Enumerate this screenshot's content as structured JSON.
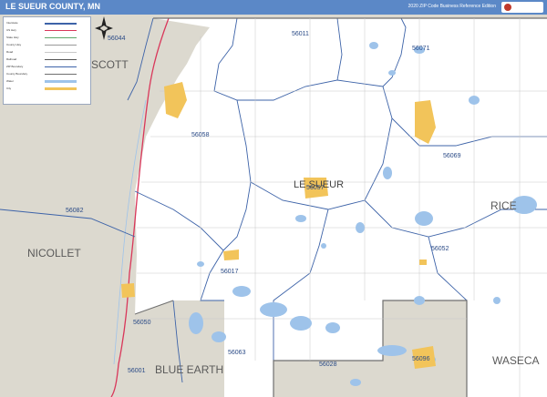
{
  "header": {
    "title": "LE SUEUR COUNTY, MN",
    "edition": "2020 ZIP Code Business Reference Edition",
    "brand": "Market MAPS"
  },
  "colors": {
    "county_fill": "#ffffff",
    "outside_fill": "#dcd9cf",
    "water": "#9ec3ea",
    "city": "#f2c45a",
    "zip_boundary": "#3d63a8",
    "river_red": "#d9375a",
    "header": "#5b88c7"
  },
  "map": {
    "zip_labels": [
      "56011",
      "56071",
      "56044",
      "56058",
      "56069",
      "56057",
      "56082",
      "56052",
      "56017",
      "56050",
      "56063",
      "56001",
      "56028",
      "56096"
    ],
    "county_labels": {
      "center": "LE SUEUR",
      "neighbors": [
        "SCOTT",
        "RICE",
        "NICOLLET",
        "BLUE EARTH",
        "WASECA"
      ]
    }
  },
  "legend": {
    "rows": [
      "Interstate",
      "US Hwy",
      "State Hwy",
      "County Hwy",
      "Road",
      "Railroad",
      "ZIP Boundary",
      "County Boundary",
      "Water",
      "City"
    ]
  }
}
